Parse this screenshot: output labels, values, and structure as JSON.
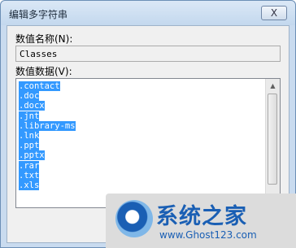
{
  "window": {
    "title": "编辑多字符串",
    "close_glyph": "X"
  },
  "form": {
    "name_label": "数值名称(N):",
    "name_value": "Classes",
    "data_label": "数值数据(V):",
    "data_lines": [
      ".contact",
      ".doc",
      ".docx",
      ".jnt",
      ".library-ms",
      ".lnk",
      ".ppt",
      ".pptx",
      ".rar",
      ".txt",
      ".xls"
    ]
  },
  "watermark": {
    "title": "系统之家",
    "url": "www.Ghost123.com"
  },
  "colors": {
    "selection": "#3399ff",
    "dialog_frame": "#c9dbef"
  }
}
